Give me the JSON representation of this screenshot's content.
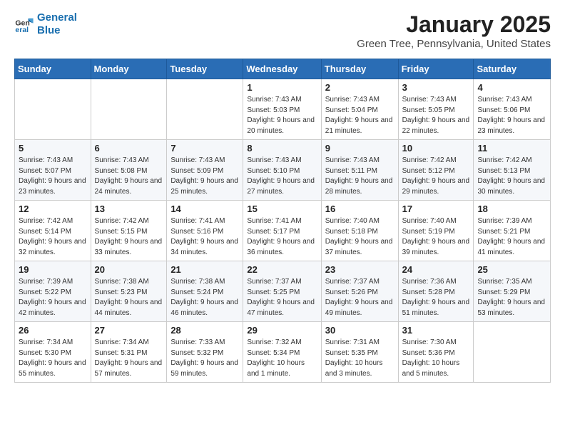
{
  "header": {
    "logo_line1": "General",
    "logo_line2": "Blue",
    "month": "January 2025",
    "location": "Green Tree, Pennsylvania, United States"
  },
  "weekdays": [
    "Sunday",
    "Monday",
    "Tuesday",
    "Wednesday",
    "Thursday",
    "Friday",
    "Saturday"
  ],
  "weeks": [
    [
      {
        "day": "",
        "sunrise": "",
        "sunset": "",
        "daylight": ""
      },
      {
        "day": "",
        "sunrise": "",
        "sunset": "",
        "daylight": ""
      },
      {
        "day": "",
        "sunrise": "",
        "sunset": "",
        "daylight": ""
      },
      {
        "day": "1",
        "sunrise": "Sunrise: 7:43 AM",
        "sunset": "Sunset: 5:03 PM",
        "daylight": "Daylight: 9 hours and 20 minutes."
      },
      {
        "day": "2",
        "sunrise": "Sunrise: 7:43 AM",
        "sunset": "Sunset: 5:04 PM",
        "daylight": "Daylight: 9 hours and 21 minutes."
      },
      {
        "day": "3",
        "sunrise": "Sunrise: 7:43 AM",
        "sunset": "Sunset: 5:05 PM",
        "daylight": "Daylight: 9 hours and 22 minutes."
      },
      {
        "day": "4",
        "sunrise": "Sunrise: 7:43 AM",
        "sunset": "Sunset: 5:06 PM",
        "daylight": "Daylight: 9 hours and 23 minutes."
      }
    ],
    [
      {
        "day": "5",
        "sunrise": "Sunrise: 7:43 AM",
        "sunset": "Sunset: 5:07 PM",
        "daylight": "Daylight: 9 hours and 23 minutes."
      },
      {
        "day": "6",
        "sunrise": "Sunrise: 7:43 AM",
        "sunset": "Sunset: 5:08 PM",
        "daylight": "Daylight: 9 hours and 24 minutes."
      },
      {
        "day": "7",
        "sunrise": "Sunrise: 7:43 AM",
        "sunset": "Sunset: 5:09 PM",
        "daylight": "Daylight: 9 hours and 25 minutes."
      },
      {
        "day": "8",
        "sunrise": "Sunrise: 7:43 AM",
        "sunset": "Sunset: 5:10 PM",
        "daylight": "Daylight: 9 hours and 27 minutes."
      },
      {
        "day": "9",
        "sunrise": "Sunrise: 7:43 AM",
        "sunset": "Sunset: 5:11 PM",
        "daylight": "Daylight: 9 hours and 28 minutes."
      },
      {
        "day": "10",
        "sunrise": "Sunrise: 7:42 AM",
        "sunset": "Sunset: 5:12 PM",
        "daylight": "Daylight: 9 hours and 29 minutes."
      },
      {
        "day": "11",
        "sunrise": "Sunrise: 7:42 AM",
        "sunset": "Sunset: 5:13 PM",
        "daylight": "Daylight: 9 hours and 30 minutes."
      }
    ],
    [
      {
        "day": "12",
        "sunrise": "Sunrise: 7:42 AM",
        "sunset": "Sunset: 5:14 PM",
        "daylight": "Daylight: 9 hours and 32 minutes."
      },
      {
        "day": "13",
        "sunrise": "Sunrise: 7:42 AM",
        "sunset": "Sunset: 5:15 PM",
        "daylight": "Daylight: 9 hours and 33 minutes."
      },
      {
        "day": "14",
        "sunrise": "Sunrise: 7:41 AM",
        "sunset": "Sunset: 5:16 PM",
        "daylight": "Daylight: 9 hours and 34 minutes."
      },
      {
        "day": "15",
        "sunrise": "Sunrise: 7:41 AM",
        "sunset": "Sunset: 5:17 PM",
        "daylight": "Daylight: 9 hours and 36 minutes."
      },
      {
        "day": "16",
        "sunrise": "Sunrise: 7:40 AM",
        "sunset": "Sunset: 5:18 PM",
        "daylight": "Daylight: 9 hours and 37 minutes."
      },
      {
        "day": "17",
        "sunrise": "Sunrise: 7:40 AM",
        "sunset": "Sunset: 5:19 PM",
        "daylight": "Daylight: 9 hours and 39 minutes."
      },
      {
        "day": "18",
        "sunrise": "Sunrise: 7:39 AM",
        "sunset": "Sunset: 5:21 PM",
        "daylight": "Daylight: 9 hours and 41 minutes."
      }
    ],
    [
      {
        "day": "19",
        "sunrise": "Sunrise: 7:39 AM",
        "sunset": "Sunset: 5:22 PM",
        "daylight": "Daylight: 9 hours and 42 minutes."
      },
      {
        "day": "20",
        "sunrise": "Sunrise: 7:38 AM",
        "sunset": "Sunset: 5:23 PM",
        "daylight": "Daylight: 9 hours and 44 minutes."
      },
      {
        "day": "21",
        "sunrise": "Sunrise: 7:38 AM",
        "sunset": "Sunset: 5:24 PM",
        "daylight": "Daylight: 9 hours and 46 minutes."
      },
      {
        "day": "22",
        "sunrise": "Sunrise: 7:37 AM",
        "sunset": "Sunset: 5:25 PM",
        "daylight": "Daylight: 9 hours and 47 minutes."
      },
      {
        "day": "23",
        "sunrise": "Sunrise: 7:37 AM",
        "sunset": "Sunset: 5:26 PM",
        "daylight": "Daylight: 9 hours and 49 minutes."
      },
      {
        "day": "24",
        "sunrise": "Sunrise: 7:36 AM",
        "sunset": "Sunset: 5:28 PM",
        "daylight": "Daylight: 9 hours and 51 minutes."
      },
      {
        "day": "25",
        "sunrise": "Sunrise: 7:35 AM",
        "sunset": "Sunset: 5:29 PM",
        "daylight": "Daylight: 9 hours and 53 minutes."
      }
    ],
    [
      {
        "day": "26",
        "sunrise": "Sunrise: 7:34 AM",
        "sunset": "Sunset: 5:30 PM",
        "daylight": "Daylight: 9 hours and 55 minutes."
      },
      {
        "day": "27",
        "sunrise": "Sunrise: 7:34 AM",
        "sunset": "Sunset: 5:31 PM",
        "daylight": "Daylight: 9 hours and 57 minutes."
      },
      {
        "day": "28",
        "sunrise": "Sunrise: 7:33 AM",
        "sunset": "Sunset: 5:32 PM",
        "daylight": "Daylight: 9 hours and 59 minutes."
      },
      {
        "day": "29",
        "sunrise": "Sunrise: 7:32 AM",
        "sunset": "Sunset: 5:34 PM",
        "daylight": "Daylight: 10 hours and 1 minute."
      },
      {
        "day": "30",
        "sunrise": "Sunrise: 7:31 AM",
        "sunset": "Sunset: 5:35 PM",
        "daylight": "Daylight: 10 hours and 3 minutes."
      },
      {
        "day": "31",
        "sunrise": "Sunrise: 7:30 AM",
        "sunset": "Sunset: 5:36 PM",
        "daylight": "Daylight: 10 hours and 5 minutes."
      },
      {
        "day": "",
        "sunrise": "",
        "sunset": "",
        "daylight": ""
      }
    ]
  ]
}
